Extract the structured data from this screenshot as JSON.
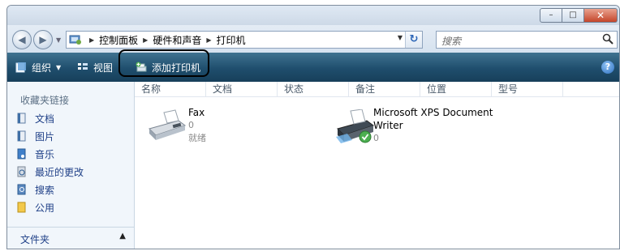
{
  "window": {
    "buttons": {
      "minimize": "–",
      "maximize": "□",
      "close": "✕"
    }
  },
  "address": {
    "back_icon": "back-arrow-icon",
    "forward_icon": "forward-arrow-icon",
    "crumbs": [
      "控制面板",
      "硬件和声音",
      "打印机"
    ],
    "search_placeholder": "搜索"
  },
  "toolbar": {
    "organize": "组织",
    "views": "视图",
    "add_printer": "添加打印机",
    "help": "?"
  },
  "sidebar": {
    "favorites_title": "收藏夹链接",
    "links": [
      {
        "label": "文档",
        "icon": "documents-icon"
      },
      {
        "label": "图片",
        "icon": "pictures-icon"
      },
      {
        "label": "音乐",
        "icon": "music-icon"
      },
      {
        "label": "最近的更改",
        "icon": "recent-changes-icon"
      },
      {
        "label": "搜索",
        "icon": "search-folder-icon"
      },
      {
        "label": "公用",
        "icon": "public-folder-icon"
      }
    ],
    "folders_label": "文件夹"
  },
  "columns": [
    "名称",
    "文档",
    "状态",
    "备注",
    "位置",
    "型号"
  ],
  "printers": [
    {
      "name": "Fax",
      "documents": "0",
      "status": "就绪"
    },
    {
      "name_line1": "Microsoft XPS Document",
      "name_line2": "Writer",
      "documents": "0"
    }
  ],
  "colors": {
    "toolbar": "#1f4e6d",
    "link": "#1e3f87",
    "window_bg": "#e7eef6"
  }
}
